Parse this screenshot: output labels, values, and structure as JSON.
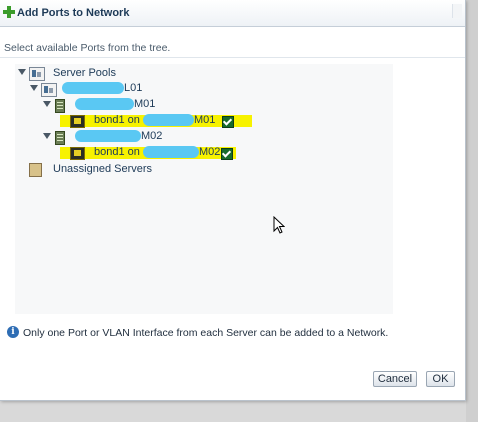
{
  "dialog": {
    "title": "Add Ports to Network",
    "instruction": "Select available Ports from the tree.",
    "info_message": "Only one Port or VLAN Interface from each Server can be added to a Network.",
    "buttons": {
      "cancel": "Cancel",
      "ok": "OK"
    }
  },
  "tree": {
    "root_label": "Server Pools",
    "pool_label_suffix": "L01",
    "servers": [
      {
        "label_suffix": "M01",
        "port_label_prefix": "bond1 on",
        "port_label_suffix": "M01",
        "checked": true
      },
      {
        "label_suffix": "M02",
        "port_label_prefix": "bond1 on",
        "port_label_suffix": "M02",
        "checked": true
      }
    ],
    "unassigned_label": "Unassigned Servers"
  },
  "colors": {
    "highlight": "#f7f200",
    "checkbox": "#176a2c",
    "redaction": "#5ac8f3",
    "title_icon": "#3a9b2a"
  }
}
